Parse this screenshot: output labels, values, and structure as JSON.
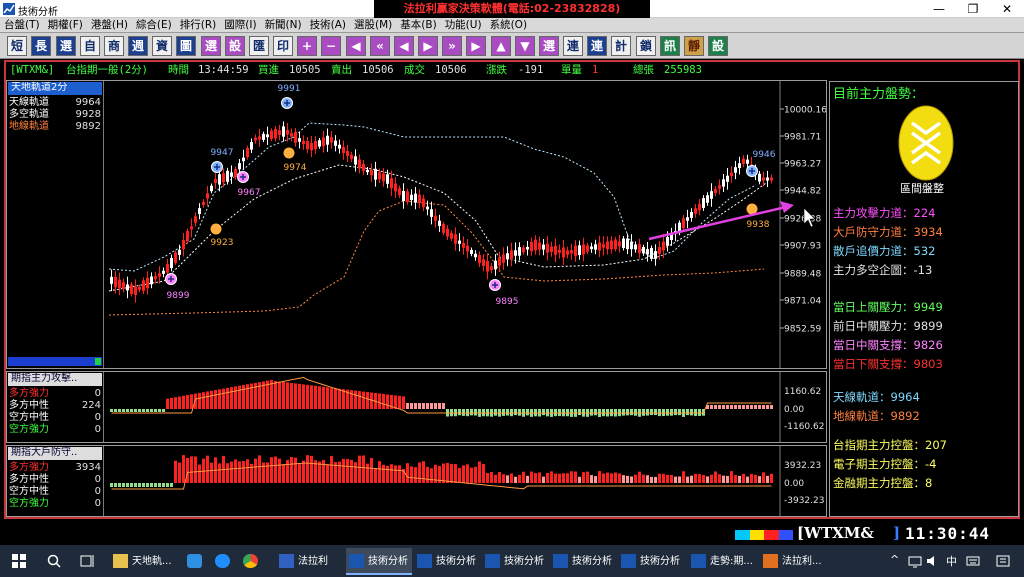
{
  "window": {
    "title": "技術分析",
    "banner": "法拉利贏家決策軟體(電話:02-23832828)",
    "controls": [
      "—",
      "❐",
      "✕"
    ]
  },
  "menu": [
    "台盤(T)",
    "期權(F)",
    "港盤(H)",
    "綜合(E)",
    "排行(R)",
    "國際(I)",
    "新聞(N)",
    "技術(A)",
    "選股(M)",
    "基本(B)",
    "功能(U)",
    "系統(O)"
  ],
  "toolbar": [
    "短",
    "長",
    "選",
    "自",
    "商",
    "週",
    "資",
    "圖",
    "選",
    "設",
    "匯",
    "印",
    "+",
    "−",
    "◀",
    "«",
    "◀",
    "▶",
    "»",
    "▶",
    "▲",
    "▼",
    "選",
    "連",
    "連",
    "計",
    "鎖",
    "訊",
    "靜",
    "設"
  ],
  "info": {
    "symbol": "[WTXM&]",
    "name": "台指期一般(2分)",
    "time_label": "時間",
    "time": "13:44:59",
    "bid_label": "買進",
    "bid": "10505",
    "ask_label": "賣出",
    "ask": "10506",
    "deal_label": "成交",
    "deal": "10506",
    "change_label": "漲跌",
    "change": "-191",
    "vol_label": "單量",
    "vol": "1",
    "total_label": "總張",
    "total": "255983"
  },
  "main_panel": {
    "title": "天地軌道2分",
    "legend": [
      {
        "label": "天線軌道",
        "value": "9964",
        "color": "#ffffff"
      },
      {
        "label": "多空軌道",
        "value": "9928",
        "color": "#ffffff"
      },
      {
        "label": "地線軌道",
        "value": "9892",
        "color": "#ff8040"
      }
    ],
    "yticks": [
      "10000.16",
      "9981.71",
      "9963.27",
      "9944.82",
      "9926.38",
      "9907.93",
      "9889.48",
      "9871.04",
      "9852.59"
    ],
    "markers": [
      {
        "label": "9991",
        "color": "#7fb0ff"
      },
      {
        "label": "9947",
        "color": "#7fb0ff"
      },
      {
        "label": "9974",
        "color": "#ffb040"
      },
      {
        "label": "9967",
        "color": "#ff80ff"
      },
      {
        "label": "9923",
        "color": "#ffb040"
      },
      {
        "label": "9899",
        "color": "#ff80ff"
      },
      {
        "label": "9895",
        "color": "#ff80ff"
      },
      {
        "label": "9946",
        "color": "#7fb0ff"
      },
      {
        "label": "9938",
        "color": "#ffb040"
      }
    ]
  },
  "ind1": {
    "title": "期指主力攻擊..",
    "legend": [
      {
        "label": "多方強力",
        "value": "0",
        "color": "#ff3030"
      },
      {
        "label": "多方中性",
        "value": "224",
        "color": "#ffffff"
      },
      {
        "label": "空方中性",
        "value": "0",
        "color": "#ffffff"
      },
      {
        "label": "空方強力",
        "value": "0",
        "color": "#40ff40"
      }
    ],
    "yticks": [
      "1160.62",
      "0.00",
      "-1160.62"
    ]
  },
  "ind2": {
    "title": "期指大戶防守..",
    "legend": [
      {
        "label": "多方強力",
        "value": "3934",
        "color": "#ff3030"
      },
      {
        "label": "多方中性",
        "value": "0",
        "color": "#ffffff"
      },
      {
        "label": "空方中性",
        "value": "0",
        "color": "#ffffff"
      },
      {
        "label": "空方強力",
        "value": "0",
        "color": "#40ff40"
      }
    ],
    "yticks": [
      "3932.23",
      "0.00",
      "-3932.23"
    ]
  },
  "right_panel": {
    "heading": "目前主力盤勢：",
    "logo_caption": "區間盤整",
    "group1": [
      {
        "text": "主力攻擊力道：224",
        "color": "#ff50ff"
      },
      {
        "text": "大戶防守力道：3934",
        "color": "#ff8040"
      },
      {
        "text": "散戶追價力道：532",
        "color": "#7fd8ff"
      },
      {
        "text": "主力多空企圖：-13",
        "color": "#e0e0e0"
      }
    ],
    "group2": [
      {
        "text": "當日上關壓力：9949",
        "color": "#60ff60"
      },
      {
        "text": "前日中關壓力：9899",
        "color": "#e0e0e0"
      },
      {
        "text": "當日中關支撐：9826",
        "color": "#ff80ff"
      },
      {
        "text": "當日下關支撐：9803",
        "color": "#ff3030"
      }
    ],
    "group3": [
      {
        "text": "天線軌道：9964",
        "color": "#7fd8ff"
      },
      {
        "text": "地線軌道：9892",
        "color": "#ff8040"
      }
    ],
    "group4": [
      {
        "text": "台指期主力控盤：207",
        "color": "#ffff60"
      },
      {
        "text": "電子期主力控盤：-4",
        "color": "#ffff60"
      },
      {
        "text": "金融期主力控盤：8",
        "color": "#ffff60"
      }
    ]
  },
  "status": {
    "symbol": "[WTXM&",
    "bracket": "]",
    "clock": "11:30:44"
  },
  "taskbar": {
    "items": [
      {
        "label": "天地軌...",
        "active": false
      },
      {
        "label": "",
        "active": false
      },
      {
        "label": "",
        "active": false
      },
      {
        "label": "",
        "active": false
      },
      {
        "label": "法拉利",
        "active": false
      },
      {
        "label": "技術分析",
        "active": true
      },
      {
        "label": "技術分析",
        "active": false
      },
      {
        "label": "技術分析",
        "active": false
      },
      {
        "label": "技術分析",
        "active": false
      },
      {
        "label": "技術分析",
        "active": false
      },
      {
        "label": "走勢:期...",
        "active": false
      },
      {
        "label": "法拉利...",
        "active": false
      }
    ],
    "tray_ime": "中",
    "tray_arrow": "^"
  },
  "colors": {
    "frame": "#c8353a",
    "up": "#ff2020",
    "down": "#ffffff",
    "heaven": "#bfe8ff",
    "earth": "#ff8a40"
  }
}
